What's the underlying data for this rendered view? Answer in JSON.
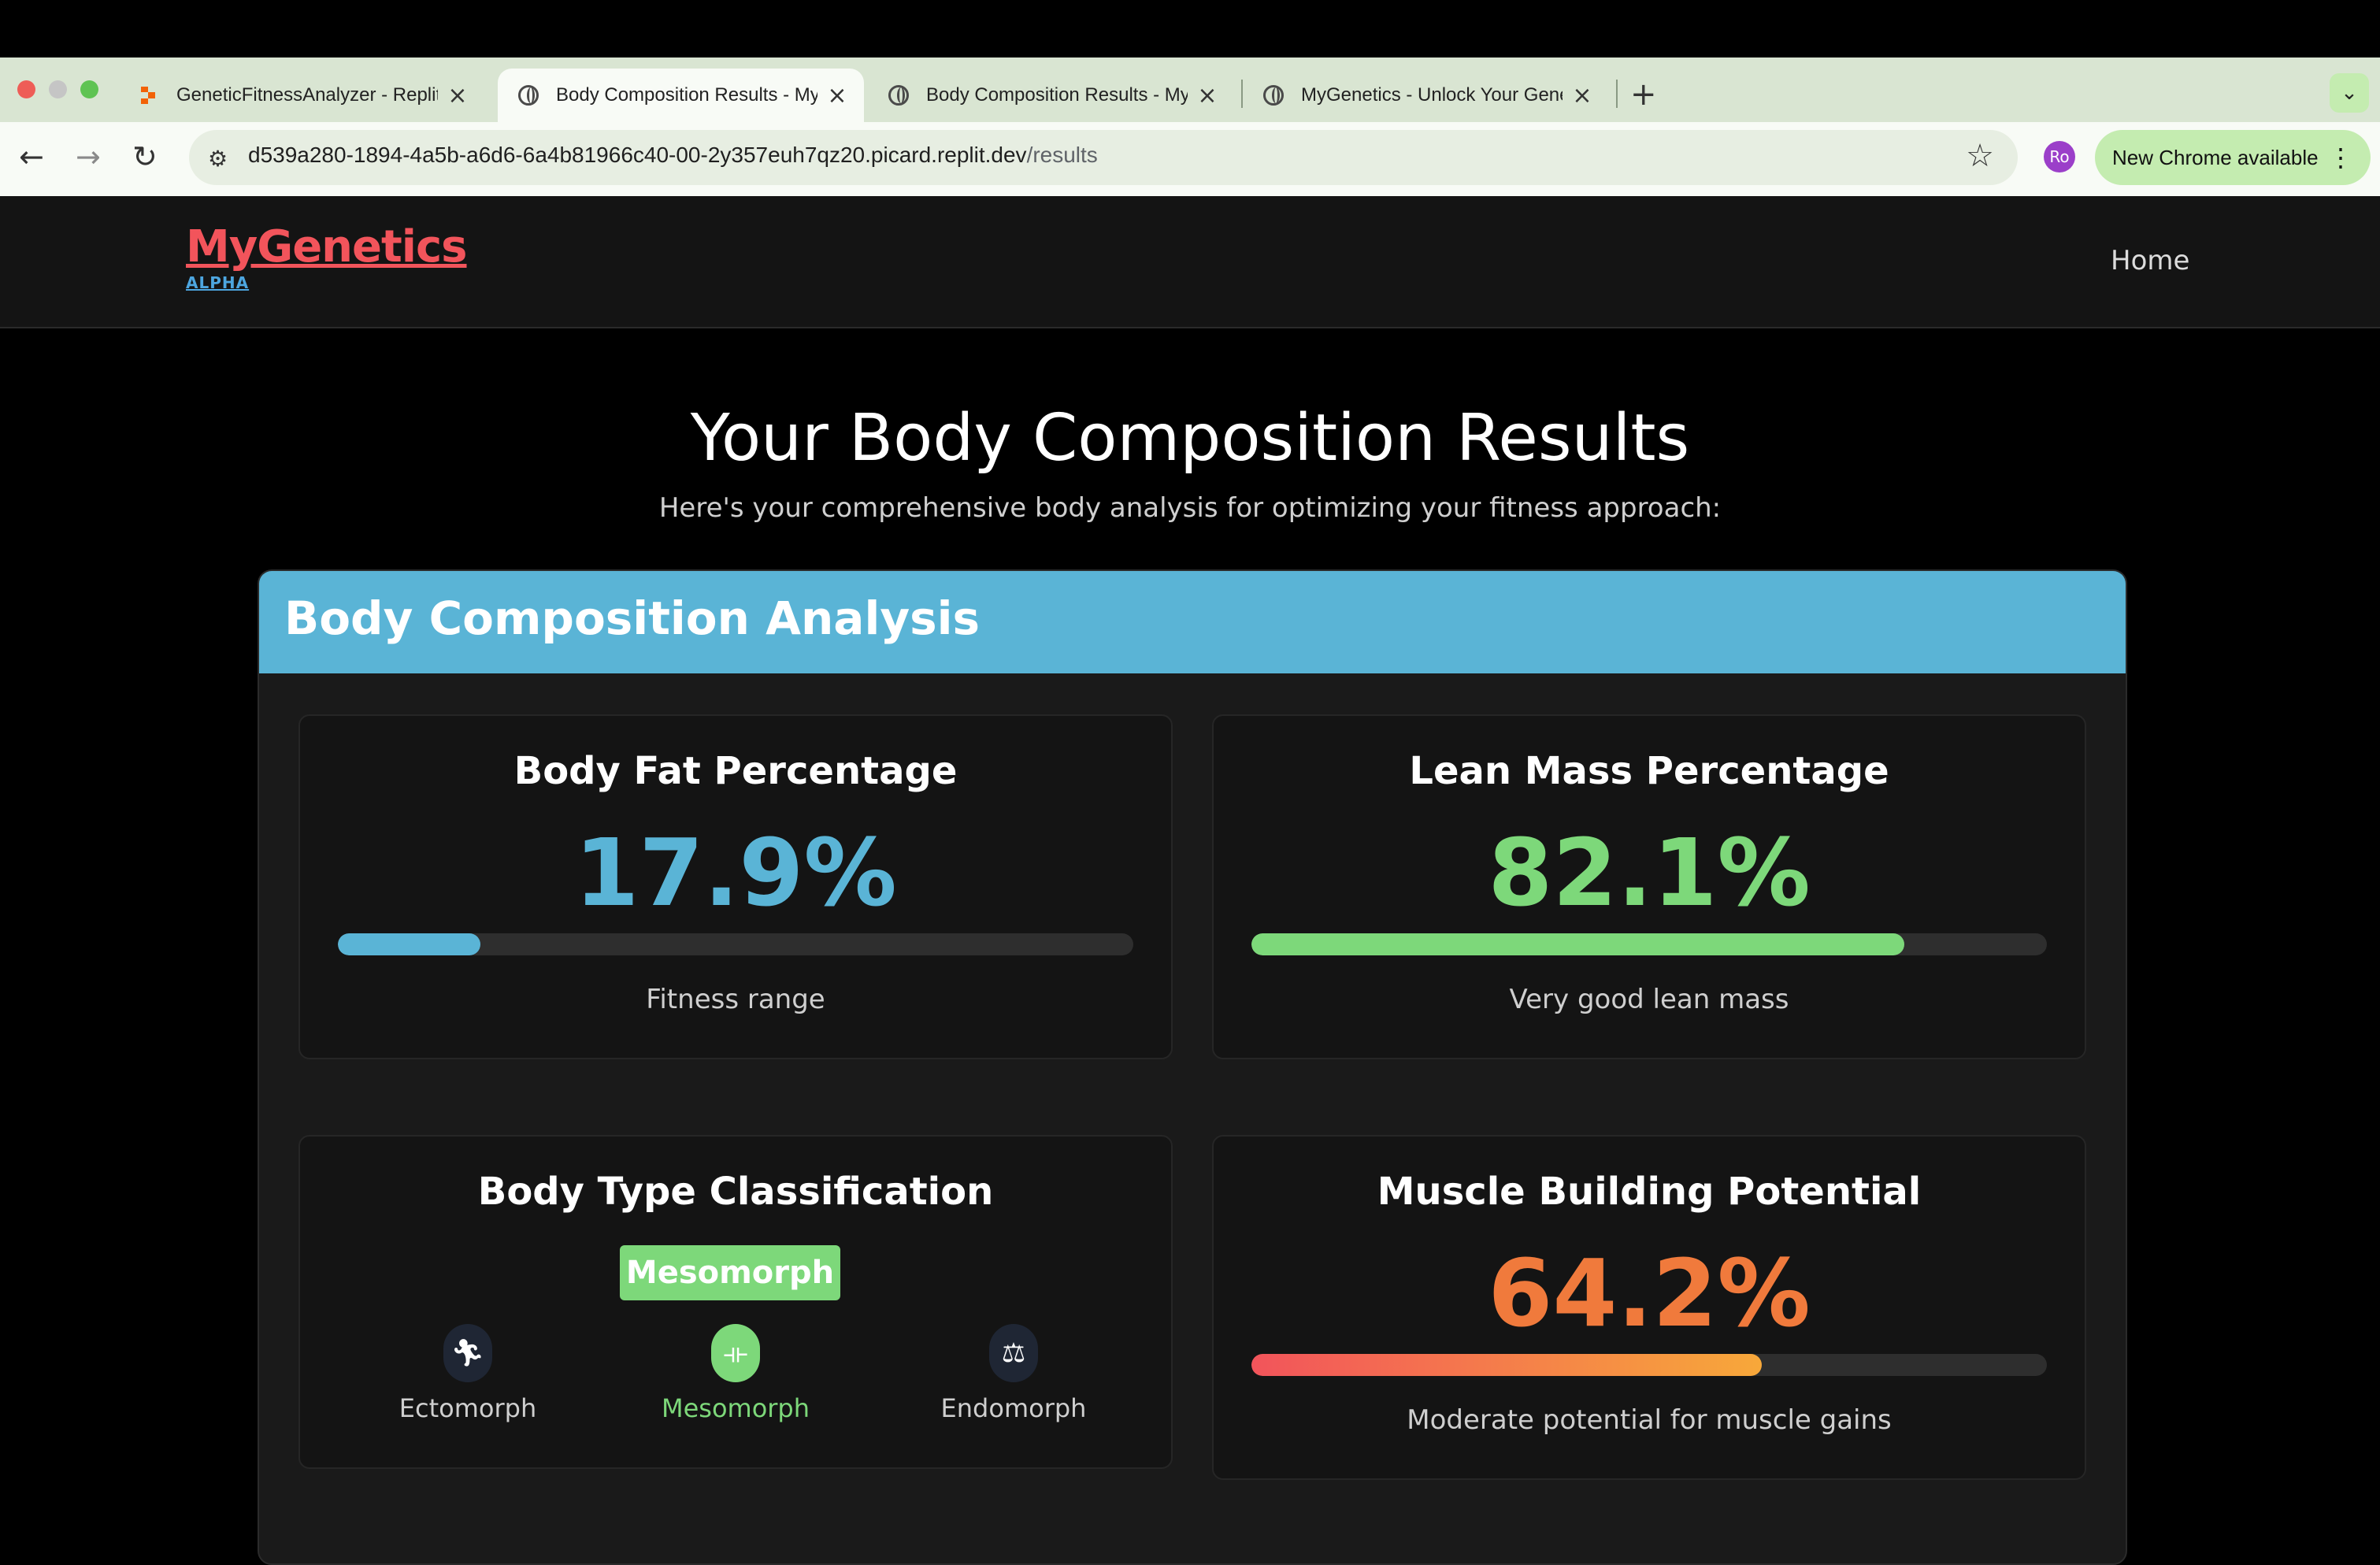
{
  "browser": {
    "tabs": [
      {
        "title": "GeneticFitnessAnalyzer - Replit",
        "active": false
      },
      {
        "title": "Body Composition Results - MyGenetics",
        "active": true
      },
      {
        "title": "Body Composition Results - MyGenetics",
        "active": false
      },
      {
        "title": "MyGenetics - Unlock Your Genetic",
        "active": false
      }
    ],
    "url_host": "d539a280-1894-4a5b-a6d6-6a4b81966c40-00-2y357euh7qz20.picard.replit.dev",
    "url_path": "/results",
    "profile_initials": "Ro",
    "update_label": "New Chrome available"
  },
  "site": {
    "logo": "MyGenetics",
    "badge": "ALPHA",
    "nav_home": "Home"
  },
  "page": {
    "title": "Your Body Composition Results",
    "subtitle": "Here's your comprehensive body analysis for optimizing your fitness approach:",
    "panel_title": "Body Composition Analysis"
  },
  "cards": {
    "body_fat": {
      "title": "Body Fat Percentage",
      "value": "17.9%",
      "progress": 0.179,
      "note": "Fitness range",
      "color": "#5ab4d6"
    },
    "lean_mass": {
      "title": "Lean Mass Percentage",
      "value": "82.1%",
      "progress": 0.821,
      "note": "Very good lean mass",
      "color": "#7dd87a"
    },
    "body_type": {
      "title": "Body Type Classification",
      "selected": "Mesomorph",
      "types": [
        {
          "label": "Ectomorph",
          "icon": "running-person-icon"
        },
        {
          "label": "Mesomorph",
          "icon": "dumbbell-icon"
        },
        {
          "label": "Endomorph",
          "icon": "weight-scale-icon"
        }
      ]
    },
    "muscle": {
      "title": "Muscle Building Potential",
      "value": "64.2%",
      "progress": 0.642,
      "note": "Moderate potential for muscle gains",
      "color_start": "#f2545b",
      "color_end": "#f7a83a"
    }
  }
}
